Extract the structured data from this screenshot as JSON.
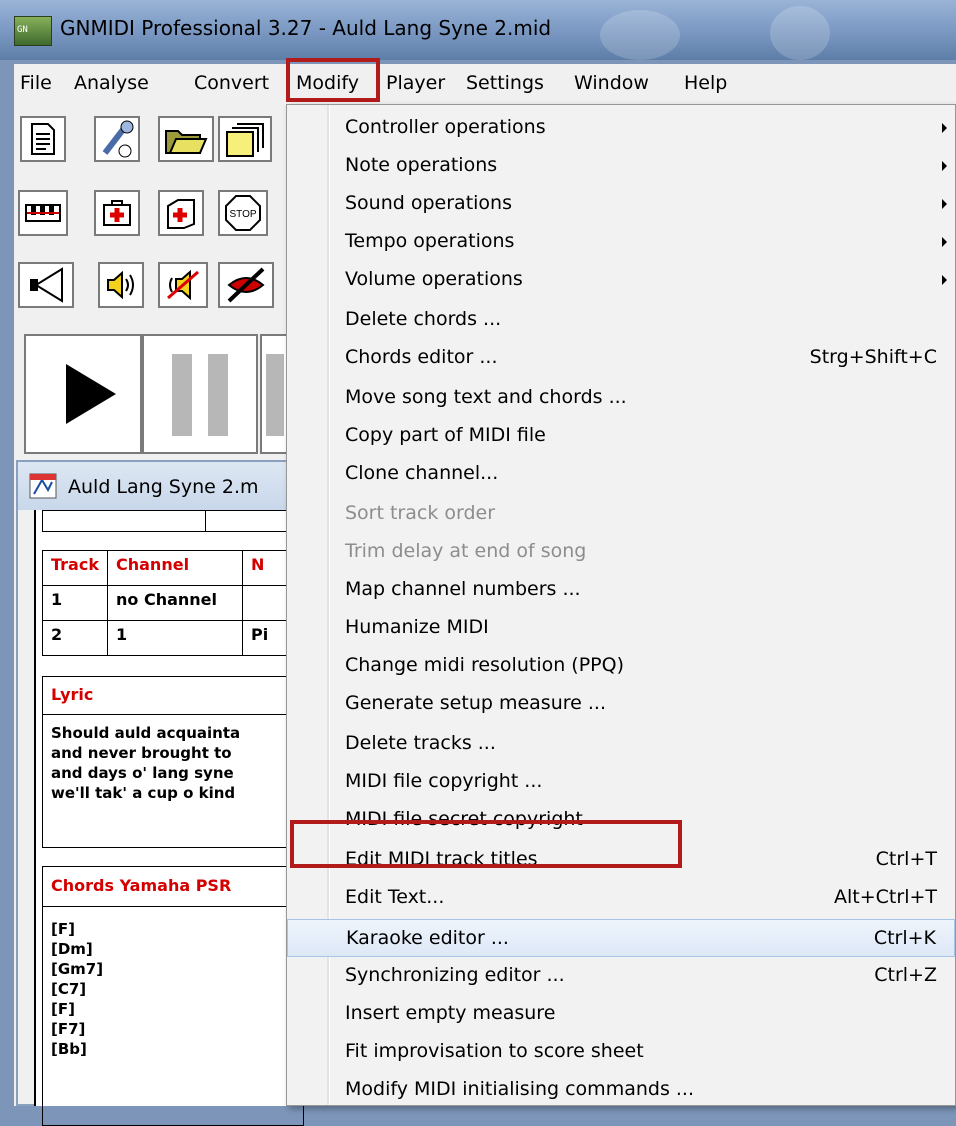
{
  "window": {
    "title": "GNMIDI Professional 3.27 - Auld Lang Syne 2.mid",
    "app_icon_text": "GN"
  },
  "menubar": [
    "File",
    "Analyse",
    "Convert",
    "Modify",
    "Player",
    "Settings",
    "Window",
    "Help"
  ],
  "child_window": {
    "title": "Auld Lang Syne 2.m",
    "tracks_table": {
      "headers": [
        "Track",
        "Channel",
        "N"
      ],
      "rows": [
        [
          "1",
          "no Channel",
          ""
        ],
        [
          "2",
          "1",
          "Pi"
        ]
      ]
    },
    "lyric": {
      "header": "Lyric",
      "lines": [
        "Should auld acquainta",
        "and never brought to",
        "and days o' lang syne",
        "we'll tak' a cup o kind"
      ]
    },
    "chords": {
      "header": "Chords Yamaha PSR",
      "lines": [
        "[F]",
        "[Dm]",
        "[Gm7]",
        "[C7]",
        "[F]",
        "[F7]",
        "[Bb]"
      ]
    }
  },
  "modify_menu": [
    {
      "label": "Controller operations",
      "submenu": true
    },
    {
      "label": "Note operations",
      "submenu": true
    },
    {
      "label": "Sound operations",
      "submenu": true
    },
    {
      "label": "Tempo operations",
      "submenu": true
    },
    {
      "label": "Volume operations",
      "submenu": true
    },
    {
      "label": "Delete chords ..."
    },
    {
      "label": "Chords editor  ...",
      "shortcut": "Strg+Shift+C"
    },
    {
      "label": "Move song text and chords ..."
    },
    {
      "label": "Copy part of MIDI file"
    },
    {
      "label": "Clone channel..."
    },
    {
      "label": "Sort track order",
      "disabled": true
    },
    {
      "label": "Trim delay at end of song",
      "disabled": true
    },
    {
      "label": "Map channel numbers ..."
    },
    {
      "label": "Humanize MIDI"
    },
    {
      "label": "Change midi resolution (PPQ)"
    },
    {
      "label": "Generate setup measure ..."
    },
    {
      "label": "Delete tracks ..."
    },
    {
      "label": "MIDI file copyright ..."
    },
    {
      "label": "MIDI file secret copyright"
    },
    {
      "label": "Edit MIDI track titles",
      "shortcut": "Ctrl+T"
    },
    {
      "label": "Edit Text...",
      "shortcut": "Alt+Ctrl+T"
    },
    {
      "label": "Karaoke editor ...",
      "shortcut": "Ctrl+K",
      "highlighted": true
    },
    {
      "label": "Synchronizing editor ...",
      "shortcut": "Ctrl+Z"
    },
    {
      "label": "Insert empty measure"
    },
    {
      "label": "Fit improvisation to score sheet"
    },
    {
      "label": "Modify MIDI initialising commands  ..."
    }
  ],
  "toolbar_icons": [
    [
      "new-document-icon",
      "midi-cable-icon",
      "open-folder-icon",
      "open-multiple-icon"
    ],
    [
      "keyboard-icon",
      "repair-kit-icon",
      "first-aid-icon",
      "stop-sign-icon"
    ],
    [
      "cone-speaker-icon",
      "speaker-volume-icon",
      "mute-speaker-icon",
      "no-lips-icon"
    ],
    [
      "play-icon",
      "pause-icon",
      "stop-transport-icon"
    ]
  ],
  "stop_sign_text": "STOP",
  "colors": {
    "highlight_box": "#b31b1b",
    "table_header_red": "#d40000"
  }
}
